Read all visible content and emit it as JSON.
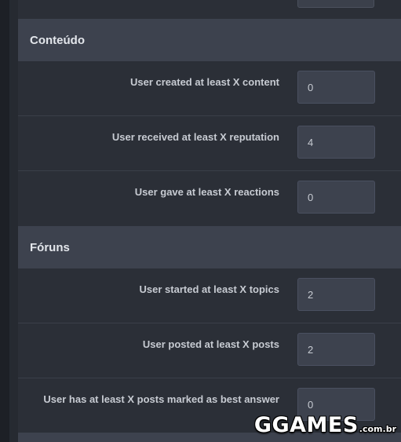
{
  "sections": [
    {
      "title": "Conteúdo",
      "rows": [
        {
          "label": "User created at least X content",
          "value": "0"
        },
        {
          "label": "User received at least X reputation",
          "value": "4"
        },
        {
          "label": "User gave at least X reactions",
          "value": "0"
        }
      ]
    },
    {
      "title": "Fóruns",
      "rows": [
        {
          "label": "User started at least X topics",
          "value": "2"
        },
        {
          "label": "User posted at least X posts",
          "value": "2"
        },
        {
          "label": "User has at least X posts marked as best answer",
          "value": "0"
        }
      ]
    }
  ],
  "watermark": {
    "main": "GGAMES",
    "suffix": ".com.br"
  }
}
